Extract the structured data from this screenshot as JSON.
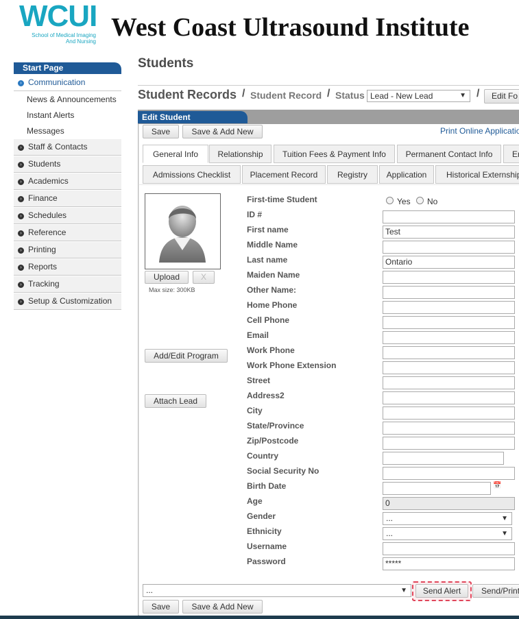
{
  "header": {
    "logo_text": "WCUI",
    "logo_sub1": "School of Medical Imaging",
    "logo_sub2": "And Nursing",
    "title": "West Coast Ultrasound Institute"
  },
  "sidebar": {
    "start": "Start Page",
    "communication": "Communication",
    "sub_items": [
      "News & Announcements",
      "Instant Alerts",
      "Messages"
    ],
    "items": [
      "Staff & Contacts",
      "Students",
      "Academics",
      "Finance",
      "Schedules",
      "Reference",
      "Printing",
      "Reports",
      "Tracking",
      "Setup & Customization"
    ]
  },
  "page": {
    "heading": "Students",
    "crumb_main": "Student Records",
    "crumb_record": "Student Record",
    "crumb_status": "Status",
    "status_value": "Lead - New Lead",
    "edit_button": "Edit Fo"
  },
  "panel": {
    "title": "Edit Student",
    "save": "Save",
    "save_add": "Save & Add New",
    "print_link": "Print Online Applicatio",
    "tabs_row1": [
      "General Info",
      "Relationship",
      "Tuition Fees & Payment Info",
      "Permanent Contact Info",
      "Er"
    ],
    "tabs_row2": [
      "Admissions Checklist",
      "Placement Record",
      "Registry",
      "Application",
      "Historical Externship"
    ],
    "upload": "Upload",
    "remove": "X",
    "max_size": "Max size: 300KB",
    "add_program": "Add/Edit Program",
    "attach_lead": "Attach Lead"
  },
  "form": {
    "first_time_label": "First-time Student",
    "yes": "Yes",
    "no": "No",
    "fields": [
      {
        "label": "ID #",
        "value": ""
      },
      {
        "label": "First name",
        "value": "Test"
      },
      {
        "label": "Middle Name",
        "value": ""
      },
      {
        "label": "Last name",
        "value": "Ontario"
      },
      {
        "label": "Maiden Name",
        "value": ""
      },
      {
        "label": "Other Name:",
        "value": ""
      },
      {
        "label": "Home Phone",
        "value": ""
      },
      {
        "label": "Cell Phone",
        "value": ""
      },
      {
        "label": "Email",
        "value": ""
      },
      {
        "label": "Work Phone",
        "value": ""
      },
      {
        "label": "Work Phone Extension",
        "value": ""
      },
      {
        "label": "Street",
        "value": ""
      },
      {
        "label": "Address2",
        "value": ""
      },
      {
        "label": "City",
        "value": ""
      },
      {
        "label": "State/Province",
        "value": ""
      },
      {
        "label": "Zip/Postcode",
        "value": ""
      },
      {
        "label": "Country",
        "value": ""
      },
      {
        "label": "Social Security No",
        "value": ""
      },
      {
        "label": "Birth Date",
        "value": ""
      },
      {
        "label": "Age",
        "value": "0"
      },
      {
        "label": "Gender",
        "value": "..."
      },
      {
        "label": "Ethnicity",
        "value": "..."
      },
      {
        "label": "Username",
        "value": ""
      },
      {
        "label": "Password",
        "value": "*****"
      }
    ]
  },
  "bottom": {
    "select_value": "...",
    "send_alert": "Send Alert",
    "send_print": "Send/Print",
    "save": "Save",
    "save_add": "Save & Add New"
  },
  "colors": {
    "brand_teal": "#19a6c1",
    "nav_blue": "#1f5a97",
    "highlight_red": "#e0455a"
  }
}
